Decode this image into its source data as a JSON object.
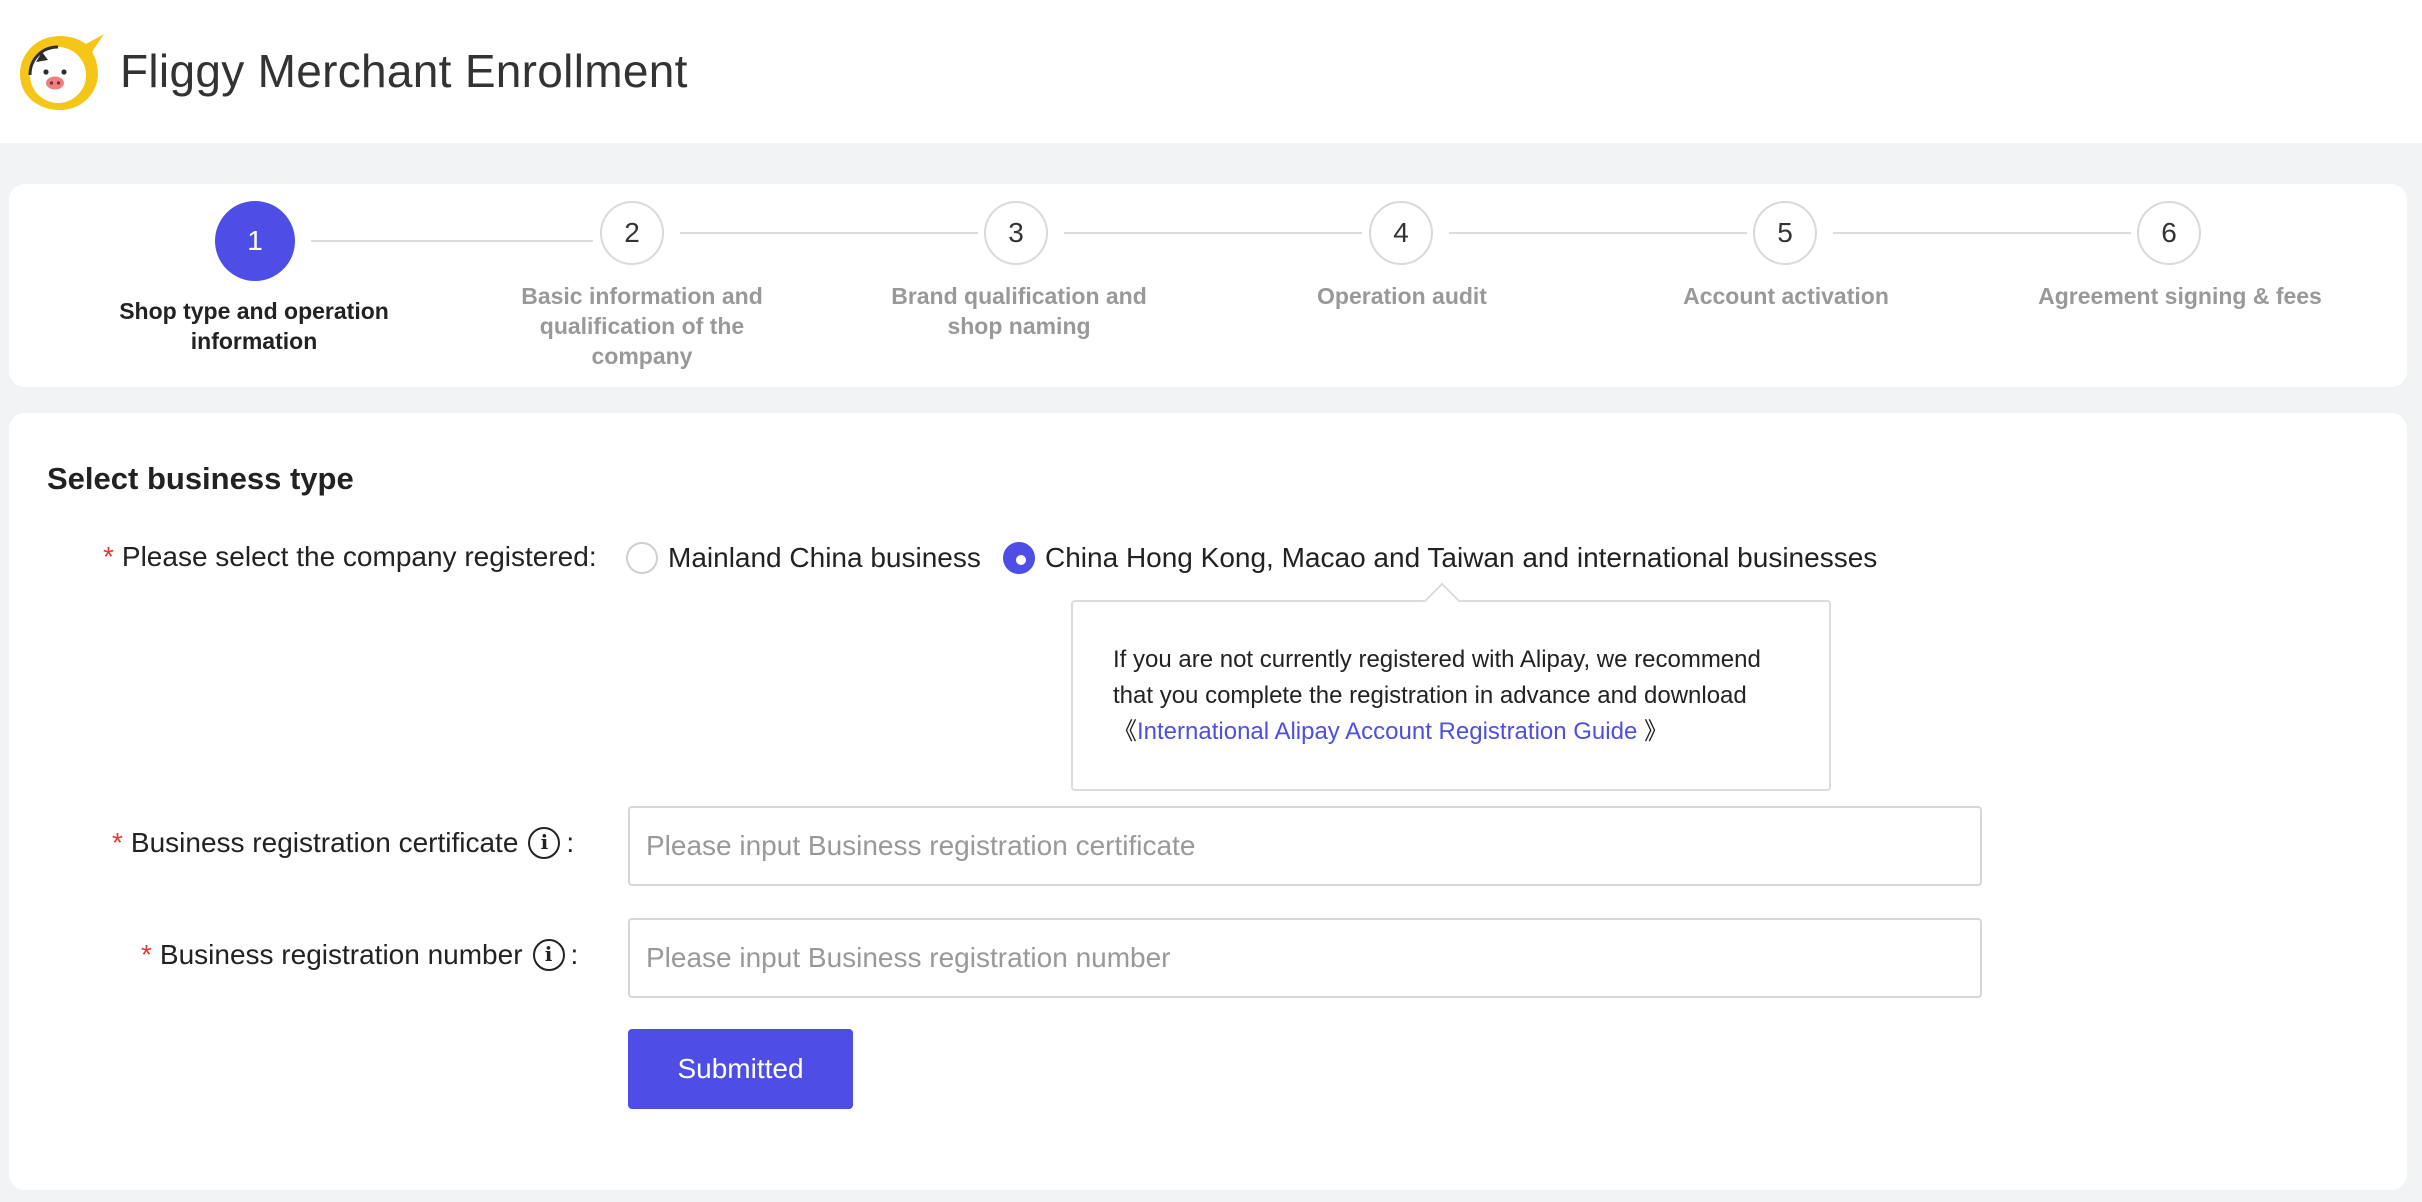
{
  "header": {
    "app_title": "Fliggy Merchant Enrollment",
    "logo_icon": "fliggy-pig-logo"
  },
  "steps": [
    {
      "number": "1",
      "label": "Shop type and operation information",
      "active": true
    },
    {
      "number": "2",
      "label": "Basic information and qualification of the company",
      "active": false
    },
    {
      "number": "3",
      "label": "Brand qualification and shop naming",
      "active": false
    },
    {
      "number": "4",
      "label": "Operation audit",
      "active": false
    },
    {
      "number": "5",
      "label": "Account activation",
      "active": false
    },
    {
      "number": "6",
      "label": "Agreement signing & fees",
      "active": false
    }
  ],
  "form": {
    "section_title": "Select business type",
    "company_registered": {
      "required_mark": "*",
      "label": "Please select the company registered:",
      "options": [
        {
          "label": "Mainland China business",
          "checked": false
        },
        {
          "label": "China Hong Kong, Macao and Taiwan and international businesses",
          "checked": true
        }
      ]
    },
    "popover": {
      "text": "If you are not currently registered with Alipay, we recommend that you complete the registration in advance and download",
      "open_bracket": "《",
      "link_text": "International Alipay Account Registration Guide",
      "close_bracket": " 》"
    },
    "certificate": {
      "required_mark": "*",
      "label": "Business registration certificate",
      "colon": ":",
      "value": "",
      "placeholder": "Please input Business registration certificate"
    },
    "reg_number": {
      "required_mark": "*",
      "label": "Business registration number",
      "colon": ":",
      "value": "",
      "placeholder": "Please input Business registration number"
    },
    "submit_label": "Submitted"
  },
  "colors": {
    "accent": "#4e4ee6",
    "required": "#e53935",
    "logo_ring": "#f5c518"
  }
}
